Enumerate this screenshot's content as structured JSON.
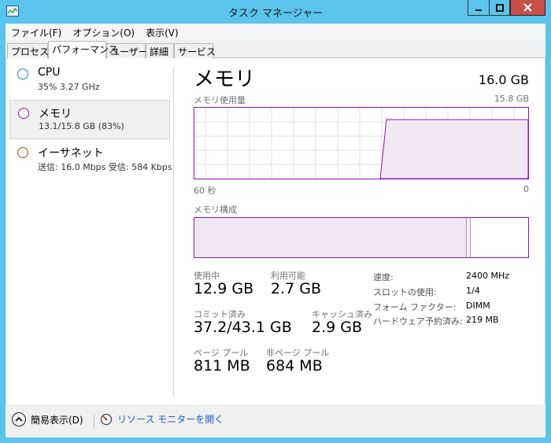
{
  "window": {
    "title": "タスク マネージャー"
  },
  "menu": [
    "ファイル(F)",
    "オプション(O)",
    "表示(V)"
  ],
  "tabs": [
    "プロセス",
    "パフォーマンス",
    "ユーザー",
    "詳細",
    "サービス"
  ],
  "active_tab": "パフォーマンス",
  "sidebar": {
    "items": [
      {
        "title": "CPU",
        "subtitle": "35% 3.27 GHz",
        "ring_color": "#1a80c4",
        "selected": false
      },
      {
        "title": "メモリ",
        "subtitle": "13.1/15.8 GB (83%)",
        "ring_color": "#8b12ae",
        "selected": true
      },
      {
        "title": "イーサネット",
        "subtitle": "送信: 16.0 Mbps 受信: 584 Kbps",
        "ring_color": "#a74f01",
        "selected": false
      }
    ]
  },
  "main": {
    "title": "メモリ",
    "total": "16.0 GB",
    "graph_label": "メモリ使用量",
    "graph_max": "15.8 GB",
    "time_left": "60 秒",
    "time_right": "0",
    "composition_label": "メモリ構成",
    "accent_color": "#8b12ae",
    "usage_fraction_recent": 0.83,
    "stats": {
      "in_use_label": "使用中",
      "in_use": "12.9 GB",
      "available_label": "利用可能",
      "available": "2.7 GB",
      "committed_label": "コミット済み",
      "committed": "37.2/43.1 GB",
      "cached_label": "キャッシュ済み",
      "cached": "2.9 GB",
      "paged_pool_label": "ページ プール",
      "paged_pool": "811 MB",
      "nonpaged_pool_label": "非ページ プール",
      "nonpaged_pool": "684 MB"
    },
    "details": [
      {
        "label": "速度:",
        "value": "2400 MHz"
      },
      {
        "label": "スロットの使用:",
        "value": "1/4"
      },
      {
        "label": "フォーム ファクター:",
        "value": "DIMM"
      },
      {
        "label": "ハードウェア予約済み:",
        "value": "219 MB"
      }
    ]
  },
  "footer": {
    "fewer_details": "簡易表示(D)",
    "resource_monitor": "リソース モニターを開く"
  }
}
